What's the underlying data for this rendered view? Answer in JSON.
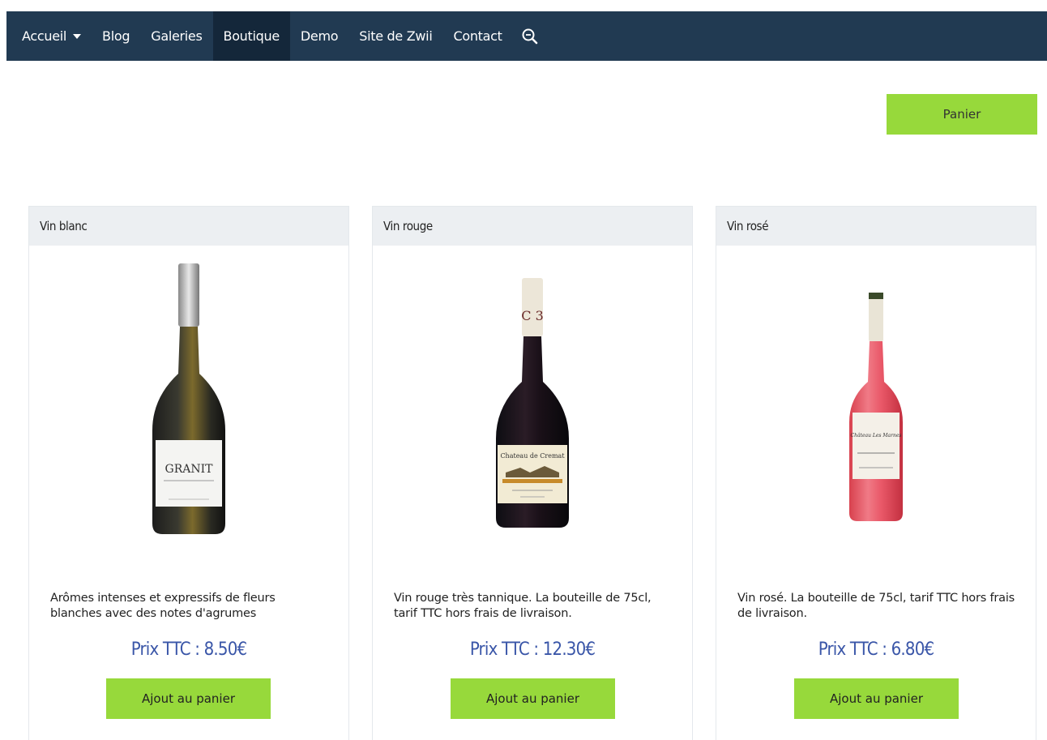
{
  "nav": {
    "items": [
      {
        "label": "Accueil"
      },
      {
        "label": "Blog"
      },
      {
        "label": "Galeries"
      },
      {
        "label": "Boutique"
      },
      {
        "label": "Demo"
      },
      {
        "label": "Site de Zwii"
      },
      {
        "label": "Contact"
      }
    ],
    "active_index": 3,
    "search_icon": "zoom-out-icon"
  },
  "panier_label": "Panier",
  "products": [
    {
      "title": "Vin blanc",
      "description": "Arômes intenses et expressifs de fleurs blanches avec des notes d'agrumes",
      "price": "Prix TTC : 8.50€",
      "button_label": "Ajout au panier",
      "image_label": "GRANIT"
    },
    {
      "title": "Vin rouge",
      "description": "Vin rouge très tannique. La bouteille de 75cl, tarif TTC hors frais de livraison.",
      "price": "Prix TTC : 12.30€",
      "button_label": "Ajout au panier",
      "image_label": "Chateau de Cremat"
    },
    {
      "title": "Vin rosé",
      "description": "Vin rosé. La bouteille de 75cl, tarif TTC hors frais de livraison.",
      "price": "Prix TTC : 6.80€",
      "button_label": "Ajout au panier",
      "image_label": "Château Les Marnes"
    }
  ],
  "colors": {
    "nav_bg": "#213a52",
    "nav_active": "#14273a",
    "button_green": "#97d93b",
    "price_blue": "#3a56a8",
    "card_header": "#eceff2"
  }
}
